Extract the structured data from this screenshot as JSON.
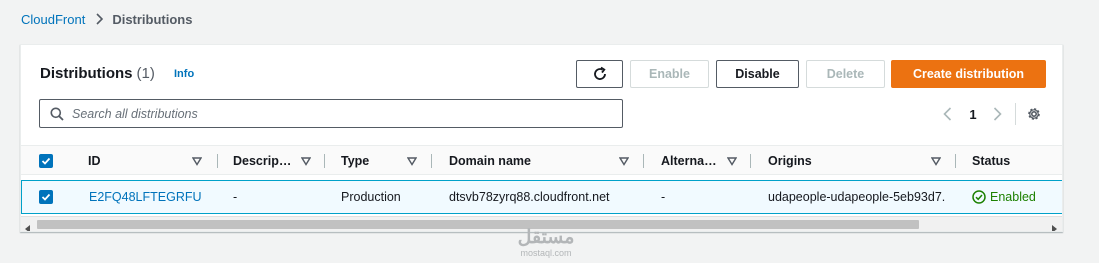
{
  "breadcrumb": {
    "parent": "CloudFront",
    "current": "Distributions"
  },
  "header": {
    "title": "Distributions",
    "count": "(1)",
    "info": "Info"
  },
  "actions": {
    "refresh_icon": "refresh-icon",
    "enable": "Enable",
    "disable": "Disable",
    "delete": "Delete",
    "create": "Create distribution"
  },
  "search": {
    "placeholder": "Search all distributions",
    "value": ""
  },
  "pagination": {
    "current_page": "1"
  },
  "table": {
    "columns": [
      "ID",
      "Descrip…",
      "Type",
      "Domain name",
      "Alterna…",
      "Origins",
      "Status"
    ],
    "rows": [
      {
        "selected": true,
        "id": "E2FQ48LFTEGRFU",
        "description": "-",
        "type": "Production",
        "domain": "dtsvb78zyrq88.cloudfront.net",
        "alternate": "-",
        "origins": "udapeople-udapeople-5eb93d7.",
        "status": "Enabled"
      }
    ]
  },
  "watermark": {
    "main": "مستقل",
    "sub": "mostaql.com"
  },
  "colors": {
    "accent": "#0073bb",
    "primary": "#ec7211",
    "success": "#1d8102",
    "selected_row": "#f1faff"
  }
}
